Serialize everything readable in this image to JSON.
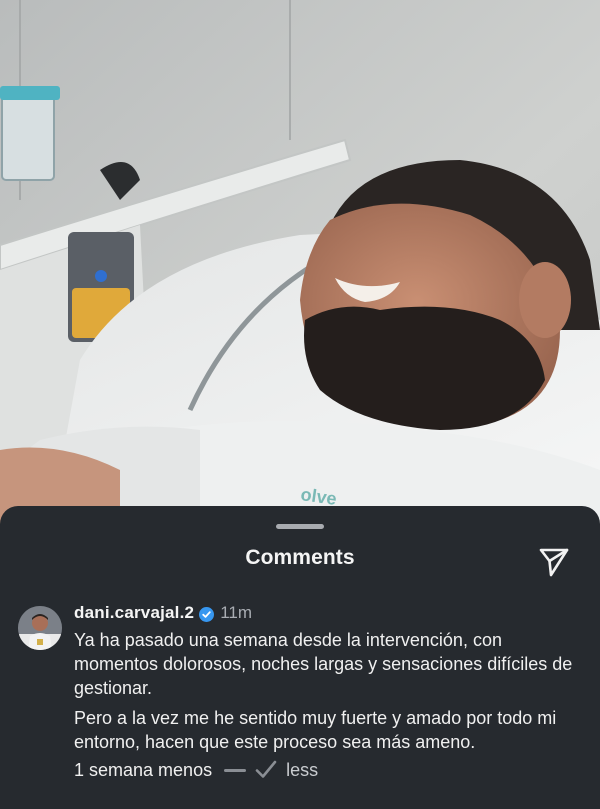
{
  "sheet": {
    "title": "Comments",
    "share_icon": "send-icon"
  },
  "comment": {
    "username": "dani.carvajal.2",
    "verified": true,
    "timestamp": "11m",
    "paragraphs": [
      "Ya ha pasado una semana desde la intervención, con momentos dolorosos, noches largas y sensaciones difíciles de gestionar.",
      "Pero a la vez me he sentido muy fuerte y amado por todo mi entorno, hacen que este proceso sea más ameno."
    ],
    "translation_label": "1 semana menos",
    "toggle_label": "less"
  },
  "colors": {
    "sheet_background": "#262a2f",
    "verified_blue": "#3797f0",
    "secondary_text": "#a9adb3"
  }
}
